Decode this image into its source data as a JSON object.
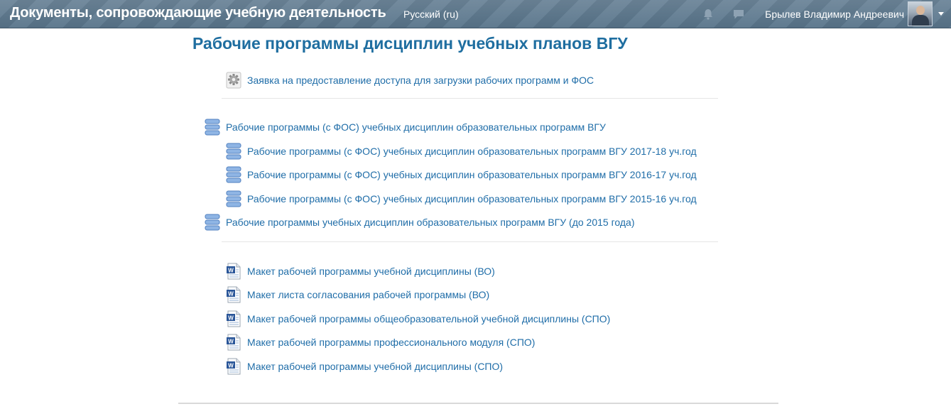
{
  "navbar": {
    "site_title": "Документы, сопровождающие учебную деятельность",
    "language": "Русский (ru)",
    "user_name": "Брылев Владимир Андреевич",
    "icons": [
      "bell-icon",
      "message-icon",
      "avatar",
      "chevron-down-icon"
    ]
  },
  "page": {
    "title": "Рабочие программы дисциплин учебных планов ВГУ"
  },
  "links": {
    "request_access": "Заявка на предоставление доступа для загрузки рабочих программ и ФОС",
    "db_main_fos": "Рабочие программы (с ФОС) учебных дисциплин образовательных программ ВГУ",
    "db_2017_18": "Рабочие программы (с ФОС) учебных дисциплин образовательных программ ВГУ 2017-18 уч.год",
    "db_2016_17": "Рабочие программы (с ФОС) учебных дисциплин образовательных программ ВГУ 2016-17 уч.год",
    "db_2015_16": "Рабочие программы (с ФОС) учебных дисциплин образовательных программ ВГУ 2015-16 уч.год",
    "db_before_2015": "Рабочие программы учебных дисциплин образовательных программ ВГУ (до 2015 года)",
    "doc_vo_program": "Макет рабочей программы учебной дисциплины (ВО)",
    "doc_vo_approval": "Макет листа согласования рабочей программы (ВО)",
    "doc_spo_general": "Макет рабочей программы общеобразовательной учебной дисциплины (СПО)",
    "doc_spo_module": "Макет рабочей программы профессионального модуля (СПО)",
    "doc_spo_discipline": "Макет рабочей программы учебной дисциплины (СПО)"
  },
  "colors": {
    "navbar": "#5f7a8f",
    "link": "#1f6da8",
    "title": "#1f6ea0"
  }
}
